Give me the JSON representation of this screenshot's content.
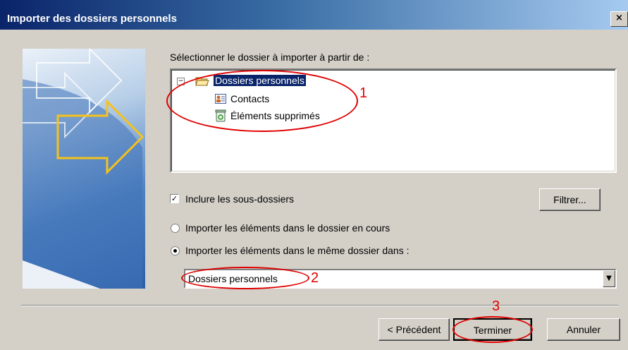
{
  "window": {
    "title": "Importer des dossiers personnels",
    "close_label": "×"
  },
  "prompt": "Sélectionner le dossier à importer à partir de :",
  "tree": {
    "root": {
      "label": "Dossiers personnels",
      "expander": "−",
      "icon": "folder-open-icon"
    },
    "children": [
      {
        "label": "Contacts",
        "icon": "contacts-icon"
      },
      {
        "label": "Éléments supprimés",
        "icon": "recycle-bin-icon"
      }
    ]
  },
  "options": {
    "include_subfolders": {
      "label": "Inclure les sous-dossiers",
      "checked": true
    },
    "filter_button": "Filtrer...",
    "radio_current": {
      "label": "Importer les éléments dans le dossier en cours",
      "selected": false
    },
    "radio_same": {
      "label": "Importer les éléments dans le même dossier dans :",
      "selected": true
    },
    "target_folder": "Dossiers personnels"
  },
  "buttons": {
    "back": "< Précédent",
    "finish": "Terminer",
    "cancel": "Annuler"
  },
  "annotations": {
    "n1": "1",
    "n2": "2",
    "n3": "3",
    "color": "#e00000"
  }
}
